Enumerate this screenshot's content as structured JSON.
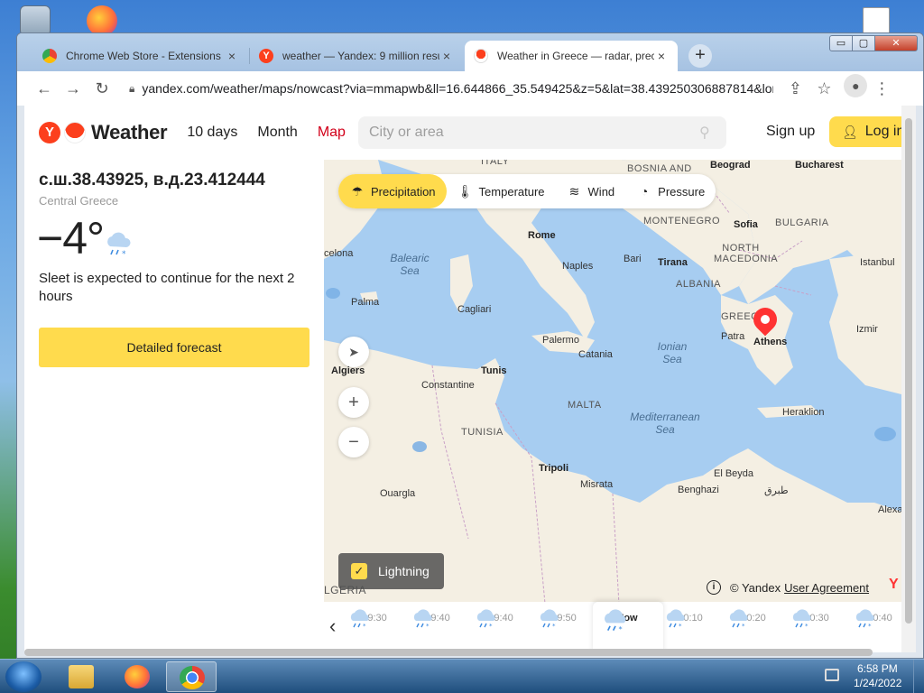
{
  "browser": {
    "tabs": [
      {
        "label": "Chrome Web Store - Extensions",
        "close": "×"
      },
      {
        "label": "weather — Yandex: 9 million results",
        "close": "×"
      },
      {
        "label": "Weather in Greece — radar, precipitation",
        "close": "×"
      }
    ],
    "new_tab": "+",
    "window_buttons": {
      "minimize": "▭",
      "maximize": "▢",
      "close": "✕"
    },
    "url": "yandex.com/weather/maps/nowcast?via=mmapwb&ll=16.644866_35.549425&z=5&lat=38.439250306887814&lon=23.412444"
  },
  "site": {
    "logo_letter": "Y",
    "logo_text": "Weather",
    "nav": {
      "ten_days": "10 days",
      "month": "Month",
      "map": "Map"
    },
    "search_placeholder": "City or area",
    "sign_up": "Sign up",
    "log_in": "Log in",
    "accent_color": "#ffdb4d",
    "active_nav_color": "#d2001a"
  },
  "location": {
    "coords": "с.ш.38.43925, в.д.23.412444",
    "region": "Central Greece",
    "temperature": "−4°",
    "condition": "Sleet is expected to continue for the next 2 hours",
    "forecast_button": "Detailed forecast"
  },
  "map": {
    "layers": [
      {
        "label": "Precipitation",
        "icon": "precipitation-icon",
        "active": true
      },
      {
        "label": "Temperature",
        "icon": "thermometer-icon",
        "active": false
      },
      {
        "label": "Wind",
        "icon": "wind-icon",
        "active": false
      },
      {
        "label": "Pressure",
        "icon": "pressure-icon",
        "active": false
      }
    ],
    "labels": {
      "italy": "ITALY",
      "bosnia": "BOSNIA AND",
      "beograd": "Beograd",
      "bucharest": "Bucharest",
      "montenegro": "MONTENEGRO",
      "sofia": "Sofia",
      "bulgaria": "BULGARIA",
      "rome": "Rome",
      "balearic_sea": "Balearic Sea",
      "barcelona": "celona",
      "naples": "Naples",
      "bari": "Bari",
      "tirana": "Tirana",
      "north_macedonia": "NORTH MACEDONIA",
      "istanbul": "Istanbul",
      "albania": "ALBANIA",
      "palma": "Palma",
      "cagliari": "Cagliari",
      "greece": "GREECE",
      "patra": "Patra",
      "athens": "Athens",
      "izmir": "Izmir",
      "palermo": "Palermo",
      "ionian_sea": "Ionian Sea",
      "algiers": "Algiers",
      "tunis": "Tunis",
      "catania": "Catania",
      "constantine": "Constantine",
      "malta": "MALTA",
      "heraklion": "Heraklion",
      "tunisia": "TUNISIA",
      "mediterranean_sea": "Mediterranean Sea",
      "tripoli": "Tripoli",
      "el_beyda": "El Beyda",
      "misrata": "Misrata",
      "benghazi": "Benghazi",
      "tobruk": "طبرق",
      "ouargla": "Ouargla",
      "alexandria": "Alexa",
      "algeria": "LGERIA"
    },
    "controls": {
      "zoom_in": "+",
      "zoom_out": "−",
      "locate": "➤"
    },
    "lightning_label": "Lightning",
    "lightning_checked": true,
    "attribution": "© Yandex",
    "agreement": "User Agreement",
    "timeline": {
      "prev": "‹",
      "slots": [
        "19:30",
        "19:40",
        "19:40",
        "19:50",
        "Now",
        "20:10",
        "20:20",
        "20:30",
        "20:40"
      ]
    }
  },
  "taskbar": {
    "time": "6:58 PM",
    "date": "1/24/2022"
  }
}
